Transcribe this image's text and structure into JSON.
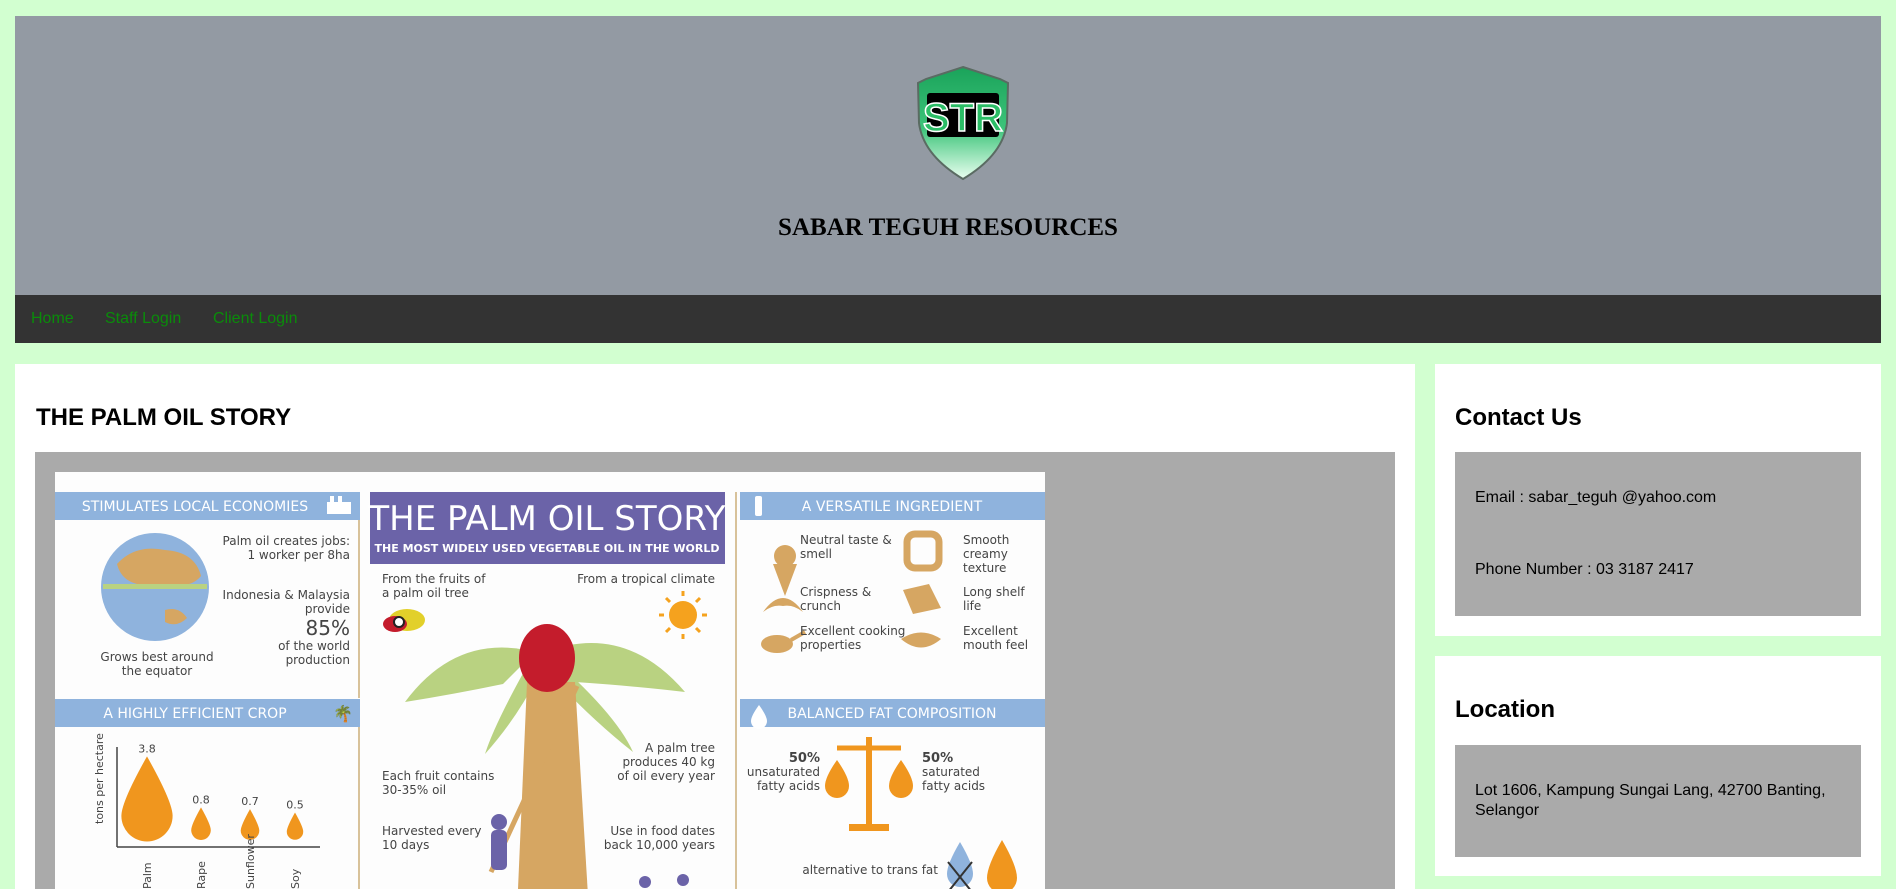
{
  "header": {
    "logo_text": "STR",
    "site_title": "SABAR TEGUH RESOURCES"
  },
  "nav": {
    "items": [
      {
        "label": "Home"
      },
      {
        "label": "Staff Login"
      },
      {
        "label": "Client Login"
      }
    ]
  },
  "main": {
    "title": "THE PALM OIL STORY",
    "infographic": {
      "title": "THE PALM OIL STORY",
      "subtitle": "THE MOST WIDELY USED VEGETABLE OIL IN THE WORLD",
      "stimulates": {
        "heading": "STIMULATES LOCAL ECONOMIES",
        "jobs": "Palm oil creates jobs:",
        "jobs2": "1 worker per 8ha",
        "indonesia1": "Indonesia & Malaysia",
        "indonesia2": "provide",
        "pct": "85%",
        "world1": "of the world",
        "world2": "production",
        "equator1": "Grows best around",
        "equator2": "the equator"
      },
      "crop": {
        "heading": "A HIGHLY EFFICIENT CROP",
        "ylabel": "tons per hectare",
        "values": [
          "3.8",
          "0.8",
          "0.7",
          "0.5"
        ],
        "labels": [
          "Palm",
          "Rape",
          "Sunflower",
          "Soy"
        ]
      },
      "center": {
        "fruits1": "From the fruits of",
        "fruits2": "a palm oil tree",
        "climate": "From a tropical climate",
        "contains1": "Each fruit contains",
        "contains2": "30-35% oil",
        "tree1": "A palm tree",
        "tree2": "produces 40 kg",
        "tree3": "of oil every year",
        "harvest1": "Harvested every",
        "harvest2": "10 days",
        "use1": "Use in food dates",
        "use2": "back 10,000 years"
      },
      "versatile": {
        "heading": "A VERSATILE INGREDIENT",
        "i1a": "Neutral taste &",
        "i1b": "smell",
        "i2a": "Smooth",
        "i2b": "creamy",
        "i2c": "texture",
        "i3a": "Crispness &",
        "i3b": "crunch",
        "i4a": "Long shelf",
        "i4b": "life",
        "i5a": "Excellent cooking",
        "i5b": "properties",
        "i6a": "Excellent",
        "i6b": "mouth feel"
      },
      "fat": {
        "heading": "BALANCED FAT COMPOSITION",
        "left_pct": "50%",
        "left1": "unsaturated",
        "left2": "fatty acids",
        "right_pct": "50%",
        "right1": "saturated",
        "right2": "fatty acids",
        "trans": "alternative to trans fat"
      }
    }
  },
  "contact": {
    "title": "Contact Us",
    "email": "Email : sabar_teguh @yahoo.com",
    "phone": "Phone Number : 03 3187 2417"
  },
  "location": {
    "title": "Location",
    "address": "Lot 1606, Kampung Sungai Lang, 42700 Banting, Selangor"
  },
  "colors": {
    "page_bg": "#d2ffd0",
    "header_bg": "#939aa3",
    "nav_bg": "#333333",
    "nav_link": "#0a8c0a",
    "panel_gray": "#aaaaaa",
    "infographic_purple": "#6b63a8",
    "infographic_blue": "#8fb3dd",
    "infographic_orange": "#f0961e"
  }
}
